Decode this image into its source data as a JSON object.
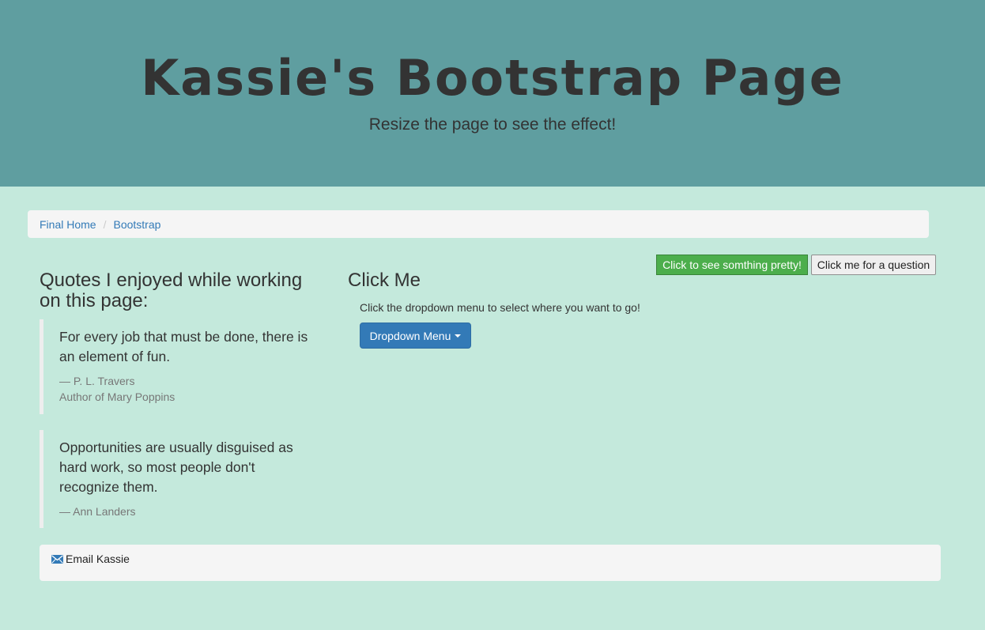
{
  "header": {
    "title": "Kassie's Bootstrap Page",
    "subtitle": "Resize the page to see the effect!"
  },
  "breadcrumb": {
    "items": [
      "Final Home",
      "Bootstrap"
    ],
    "separator": "/"
  },
  "buttons": {
    "pretty_label": "Click to see somthing pretty!",
    "question_label": "Click me for a question"
  },
  "quotes_section": {
    "heading": "Quotes I enjoyed while working on this page:",
    "quotes": [
      {
        "text": "For every job that must be done, there is an element of fun.",
        "author": "— P. L. Travers",
        "source": "Author of Mary Poppins"
      },
      {
        "text": "Opportunities are usually disguised as hard work, so most people don't recognize them.",
        "author": "— Ann Landers"
      }
    ]
  },
  "click_section": {
    "heading": "Click Me",
    "description": "Click the dropdown menu to select where you want to go!",
    "dropdown_label": "Dropdown Menu"
  },
  "footer": {
    "email_label": "Email Kassie",
    "icon": "envelope-icon"
  },
  "colors": {
    "header_bg": "#5f9ea0",
    "page_bg": "#c4e9dc",
    "primary": "#337ab7",
    "success": "#4cae4c",
    "well_bg": "#f5f5f5"
  }
}
